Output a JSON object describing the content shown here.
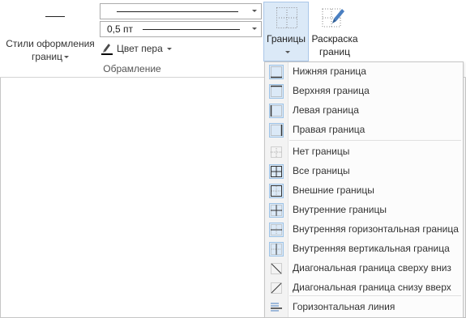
{
  "ribbon": {
    "border_styles_label": "Стили оформления границ",
    "pen_weight_value": "0,5 пт",
    "pen_color_label": "Цвет пера",
    "group_label": "Обрамление",
    "borders_label": "Границы",
    "border_painter_label": "Раскраска границ"
  },
  "menu": {
    "items": [
      {
        "label": "Нижняя граница",
        "icon": "bottom-border-icon"
      },
      {
        "label": "Верхняя граница",
        "icon": "top-border-icon"
      },
      {
        "label": "Левая граница",
        "icon": "left-border-icon"
      },
      {
        "label": "Правая граница",
        "icon": "right-border-icon"
      },
      {
        "label": "Нет границы",
        "icon": "no-border-icon"
      },
      {
        "label": "Все границы",
        "icon": "all-borders-icon"
      },
      {
        "label": "Внешние границы",
        "icon": "outside-borders-icon"
      },
      {
        "label": "Внутренние границы",
        "icon": "inside-borders-icon"
      },
      {
        "label": "Внутренняя горизонтальная граница",
        "icon": "inside-horizontal-border-icon"
      },
      {
        "label": "Внутренняя вертикальная граница",
        "icon": "inside-vertical-border-icon"
      },
      {
        "label": "Диагональная граница сверху вниз",
        "icon": "diagonal-down-border-icon"
      },
      {
        "label": "Диагональная граница снизу вверх",
        "icon": "diagonal-up-border-icon"
      },
      {
        "label": "Горизонтальная линия",
        "icon": "horizontal-line-icon"
      }
    ]
  },
  "colors": {
    "selected_bg": "#dbe9f7",
    "selected_border": "#a9c6e8",
    "pen_color": "#000000"
  }
}
